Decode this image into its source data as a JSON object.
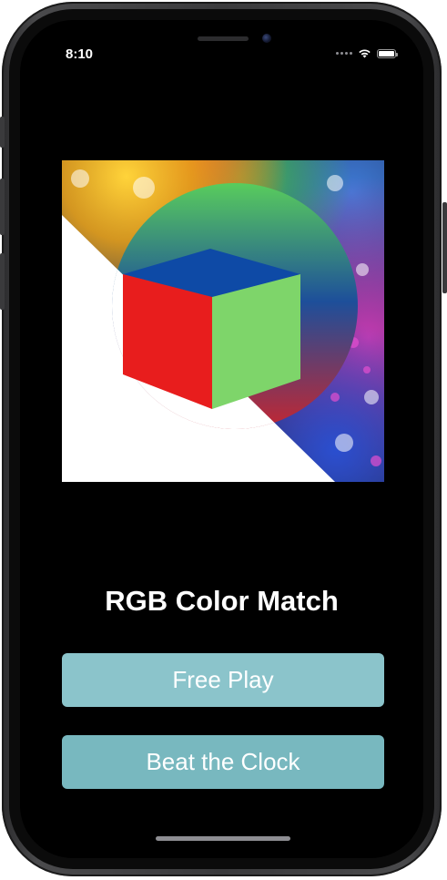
{
  "status_bar": {
    "time": "8:10",
    "signal_icon": "signal-dots-icon",
    "wifi_icon": "wifi-icon",
    "battery_icon": "battery-icon",
    "battery_level": 1.0
  },
  "logo": {
    "icon": "rgb-cube-logo",
    "colors": {
      "cube_left": "#e81d1d",
      "cube_right": "#7ed56a",
      "cube_top": "#0e4aa6",
      "circle_top": "#5bd15a",
      "circle_mid": "#1d4f9a",
      "circle_bottom": "#e02020"
    }
  },
  "main": {
    "title": "RGB Color Match",
    "buttons": [
      {
        "label": "Free Play",
        "color": "#8bc4cb"
      },
      {
        "label": "Beat the Clock",
        "color": "#78b8bf"
      }
    ]
  }
}
